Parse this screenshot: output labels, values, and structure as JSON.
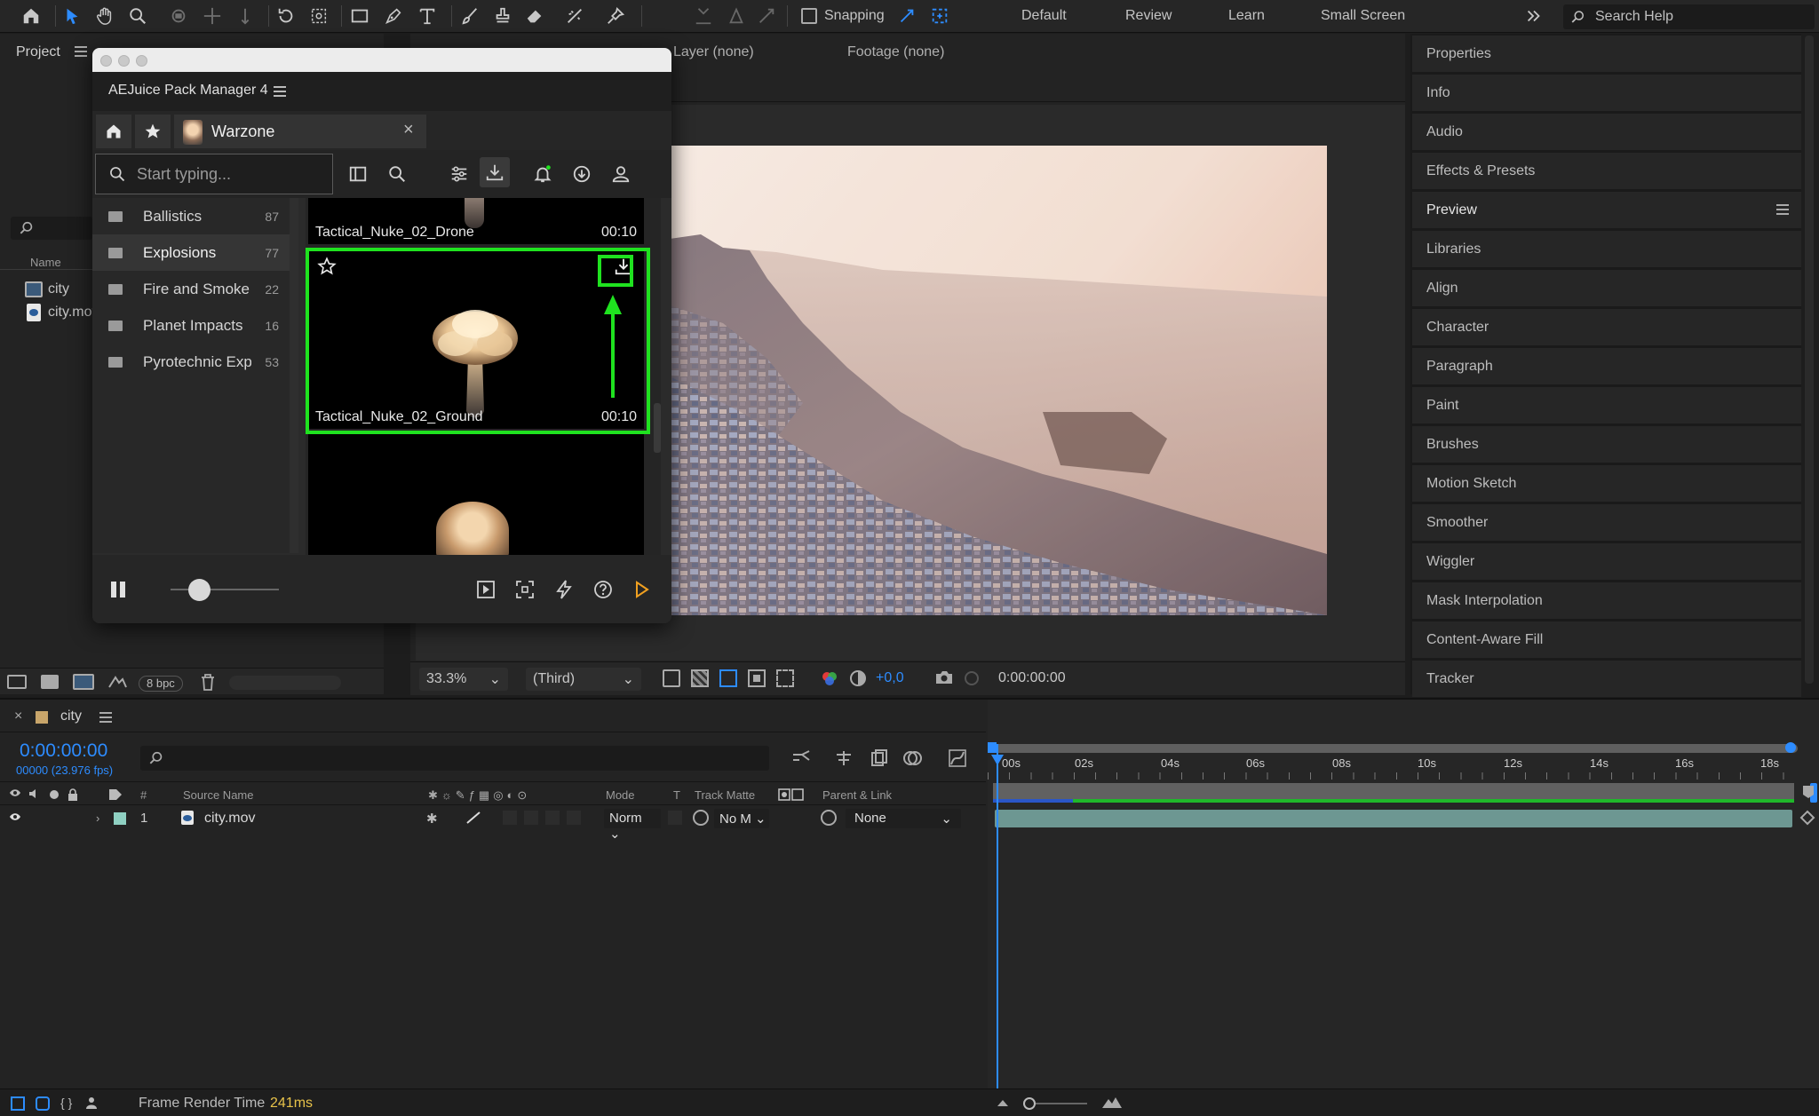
{
  "toolbar": {
    "snapping_label": "Snapping",
    "workspaces": [
      "Default",
      "Review",
      "Learn",
      "Small Screen"
    ],
    "search_placeholder": "Search Help"
  },
  "project": {
    "tab": "Project",
    "col_name": "Name",
    "items": [
      {
        "name": "city",
        "icon": "composition-icon"
      },
      {
        "name": "city.mov",
        "icon": "footage-icon"
      }
    ],
    "bpc": "8 bpc"
  },
  "viewer": {
    "tab_layer": "Layer (none)",
    "tab_footage": "Footage (none)",
    "zoom": "33.3%",
    "resolution": "(Third)",
    "exposure": "+0,0",
    "timecode": "0:00:00:00"
  },
  "right_panels": [
    "Properties",
    "Info",
    "Audio",
    "Effects & Presets",
    "Preview",
    "Libraries",
    "Align",
    "Character",
    "Paragraph",
    "Paint",
    "Brushes",
    "Motion Sketch",
    "Smoother",
    "Wiggler",
    "Mask Interpolation",
    "Content-Aware Fill",
    "Tracker"
  ],
  "timeline": {
    "comp_tab": "city",
    "timecode": "0:00:00:00",
    "fps": "00000 (23.976 fps)",
    "columns": {
      "num": "#",
      "source": "Source Name",
      "mode": "Mode",
      "t": "T",
      "matte": "Track Matte",
      "parent": "Parent & Link"
    },
    "layer": {
      "index": "1",
      "name": "city.mov",
      "mode": "Norm",
      "matte": "No M",
      "parent": "None"
    },
    "ruler": [
      "00s",
      "02s",
      "04s",
      "06s",
      "08s",
      "10s",
      "12s",
      "14s",
      "16s",
      "18s"
    ]
  },
  "status": {
    "label": "Frame Render Time",
    "value": "241ms"
  },
  "aejuice": {
    "title": "AEJuice Pack Manager 4",
    "pack_tab": "Warzone",
    "search_placeholder": "Start typing...",
    "categories": [
      {
        "name": "Ballistics",
        "count": "87"
      },
      {
        "name": "Explosions",
        "count": "77"
      },
      {
        "name": "Fire and Smoke",
        "count": "22"
      },
      {
        "name": "Planet Impacts",
        "count": "16"
      },
      {
        "name": "Pyrotechnic Explosions",
        "count": "53"
      }
    ],
    "selected_category": "Explosions",
    "items": [
      {
        "name": "Tactical_Nuke_02_Drone",
        "duration": "00:10"
      },
      {
        "name": "Tactical_Nuke_02_Ground",
        "duration": "00:10"
      }
    ],
    "colors": {
      "annotation": "#1fe21f",
      "accent": "#f0a020"
    }
  }
}
